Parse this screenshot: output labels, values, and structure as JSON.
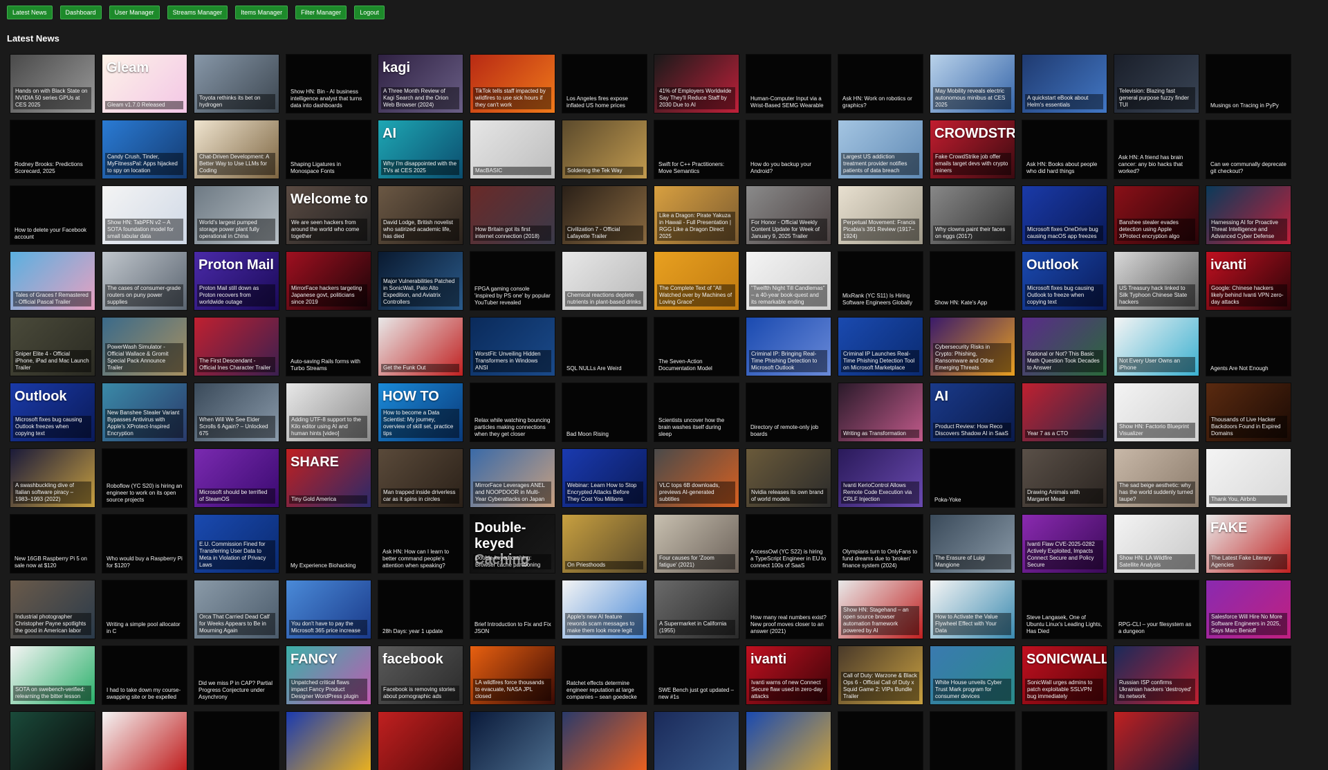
{
  "nav": [
    {
      "label": "Latest News",
      "name": "nav-latest-news-button"
    },
    {
      "label": "Dashboard",
      "name": "nav-dashboard-button"
    },
    {
      "label": "User Manager",
      "name": "nav-user-manager-button"
    },
    {
      "label": "Streams Manager",
      "name": "nav-streams-manager-button"
    },
    {
      "label": "Items Manager",
      "name": "nav-items-manager-button"
    },
    {
      "label": "Filter Manager",
      "name": "nav-filter-manager-button"
    },
    {
      "label": "Logout",
      "name": "nav-logout-button"
    }
  ],
  "page_title": "Latest News",
  "colors": {
    "accent": "#1d8a2a",
    "page_bg": "#1a1a1a",
    "card_bg": "#050505"
  },
  "news": [
    {
      "title": "Hands on with Black State on NVIDIA 50 series GPUs at CES 2025",
      "thumb": "#4a4a4a,#9a9a9a"
    },
    {
      "title": "Gleam v1.7.0 Released",
      "thumb": "#fdf3e8,#f3c6e6",
      "text": "Gleam"
    },
    {
      "title": "Toyota rethinks its bet on hydrogen",
      "thumb": "#8797a8,#3c4650"
    },
    {
      "title": "Show HN: Bin - AI business intelligence analyst that turns data into dashboards",
      "thumb": ""
    },
    {
      "title": "A Three Month Review of Kagi Search and the Orion Web Browser (2024)",
      "thumb": "#2f2142,#6a5f86",
      "text": "kagi"
    },
    {
      "title": "TikTok tells staff impacted by wildfires to use sick hours if they can't work",
      "thumb": "#b82a14,#f07a1a"
    },
    {
      "title": "Los Angeles fires expose inflated US home prices",
      "thumb": ""
    },
    {
      "title": "41% of Employers Worldwide Say They'll Reduce Staff by 2030 Due to AI",
      "thumb": "#1a1a1a,#c0203a"
    },
    {
      "title": "Human-Computer Input via a Wrist-Based SEMG Wearable",
      "thumb": ""
    },
    {
      "title": "Ask HN: Work on robotics or graphics?",
      "thumb": ""
    },
    {
      "title": "May Mobility reveals electric autonomous minibus at CES 2025",
      "thumb": "#b9d2ea,#3464a8"
    },
    {
      "title": "A quickstart eBook about Helm's essentials",
      "thumb": "#1f3a70,#4277c4"
    },
    {
      "title": "Television: Blazing fast general purpose fuzzy finder TUI",
      "thumb": "#1a1f2a,#3a4556"
    },
    {
      "title": "Musings on Tracing in PyPy",
      "thumb": ""
    },
    {
      "title": "Rodney Brooks: Predictions Scorecard, 2025",
      "thumb": ""
    },
    {
      "title": "Candy Crush, Tinder, MyFitnessPal: Apps hijacked to spy on location",
      "thumb": "#2a7bd4,#143a70"
    },
    {
      "title": "Chat-Driven Development: A Better Way to Use LLMs for Coding",
      "thumb": "#efe4cf,#7c6440"
    },
    {
      "title": "Shaping Ligatures in Monospace Fonts",
      "thumb": ""
    },
    {
      "title": "Why I'm disappointed with the TVs at CES 2025",
      "thumb": "#1ea7b4,#0b4d6e",
      "text": "AI"
    },
    {
      "title": "MacBASIC",
      "thumb": "#e6e6e6,#bdbdbd"
    },
    {
      "title": "Soldering the Tek Way",
      "thumb": "#5b4a2c,#c29b4f"
    },
    {
      "title": "Swift for C++ Practitioners: Move Semantics",
      "thumb": ""
    },
    {
      "title": "How do you backup your Android?",
      "thumb": ""
    },
    {
      "title": "Largest US addiction treatment provider notifies patients of data breach",
      "thumb": "#a4c5e2,#5f89b4"
    },
    {
      "title": "Fake CrowdStrike job offer emails target devs with crypto miners",
      "thumb": "#c21d2f,#3a0a10",
      "text": "CROWDSTRIKE"
    },
    {
      "title": "Ask HN: Books about people who did hard things",
      "thumb": ""
    },
    {
      "title": "Ask HN: A friend has brain cancer: any bio hacks that worked?",
      "thumb": ""
    },
    {
      "title": "Can we communally deprecate git checkout?",
      "thumb": ""
    },
    {
      "title": "How to delete your Facebook account",
      "thumb": ""
    },
    {
      "title": "Show HN: TabPFN v2 – A SOTA foundation model for small tabular data",
      "thumb": "#f4f4f4,#cfd8e6"
    },
    {
      "title": "World's largest pumped storage power plant fully operational in China",
      "thumb": "#6e7a84,#b8c0c6"
    },
    {
      "title": "We are seen hackers from around the world who come together",
      "thumb": "#5a4a42,#222",
      "text": "Welcome to"
    },
    {
      "title": "David Lodge, British novelist who satirized academic life, has died",
      "thumb": "#6b5844,#2a221c"
    },
    {
      "title": "How Britain got its first internet connection (2018)",
      "thumb": "#6a2a28,#3a3a4a"
    },
    {
      "title": "Civilization 7 - Official Lafayette Trailer",
      "thumb": "#2a2018,#8a6a40"
    },
    {
      "title": "Like a Dragon: Pirate Yakuza in Hawaii - Full Presentation | RGG Like a Dragon Direct 2025",
      "thumb": "#d8a040,#7a5a30"
    },
    {
      "title": "For Honor - Official Weekly Content Update for Week of January 9, 2025 Trailer",
      "thumb": "#8a8a8a,#4a4040"
    },
    {
      "title": "Perpetual Movement: Francis Picabia's 391 Review (1917–1924)",
      "thumb": "#e8e0d0,#a09a8a"
    },
    {
      "title": "Why clowns paint their faces on eggs (2017)",
      "thumb": "#888,#333"
    },
    {
      "title": "Microsoft fixes OneDrive bug causing macOS app freezes",
      "thumb": "#1a3aa8,#0a1a58"
    },
    {
      "title": "Banshee stealer evades detection using Apple XProtect encryption algo",
      "thumb": "#8a1018,#2a0408"
    },
    {
      "title": "Harnessing AI for Proactive Threat Intelligence and Advanced Cyber Defense",
      "thumb": "#0a3a5a,#c0203a"
    },
    {
      "title": "Tales of Graces f Remastered - Official Pascal Trailer",
      "thumb": "#5ab0e0,#e8a0c0"
    },
    {
      "title": "The cases of consumer-grade routers on puny power supplies",
      "thumb": "#c0c6cc,#5a6470"
    },
    {
      "title": "Proton Mail still down as Proton recovers from worldwide outage",
      "thumb": "#4a2aa8,#1a0a58",
      "text": "Proton Mail"
    },
    {
      "title": "MirrorFace hackers targeting Japanese govt, politicians since 2019",
      "thumb": "#a01020,#1a0408"
    },
    {
      "title": "Major Vulnerabilities Patched in SonicWall, Palo Alto Expedition, and Aviatrix Controllers",
      "thumb": "#0a1a30,#2a5a8a"
    },
    {
      "title": "FPGA gaming console 'inspired by PS one' by popular YouTuber revealed",
      "thumb": ""
    },
    {
      "title": "Chemical reactions deplete nutrients in plant-based drinks",
      "thumb": "#e8e8e8,#b8b8b8"
    },
    {
      "title": "The Complete Text of \"All Watched over by Machines of Loving Grace\"",
      "thumb": "#e8a020,#c07a10"
    },
    {
      "title": "\"Twelfth Night Till Candlemas\" – a 40-year book-quest and its remarkable ending",
      "thumb": "#f4f4f4,#d0d0d0"
    },
    {
      "title": "MixRank (YC S11) Is Hiring Software Engineers Globally",
      "thumb": ""
    },
    {
      "title": "Show HN: Kate's App",
      "thumb": ""
    },
    {
      "title": "Microsoft fixes bug causing Outlook to freeze when copying text",
      "thumb": "#1a4ab0,#0a1a58",
      "text": "Outlook"
    },
    {
      "title": "US Treasury hack linked to Silk Typhoon Chinese State hackers",
      "thumb": "#d8d8d8,#5a5a5a"
    },
    {
      "title": "Google: Chinese hackers likely behind Ivanti VPN zero-day attacks",
      "thumb": "#c01020,#2a0408",
      "text": "ivanti"
    },
    {
      "title": "Sniper Elite 4 - Official iPhone, iPad and Mac Launch Trailer",
      "thumb": "#4a4a3a,#2a2a22"
    },
    {
      "title": "PowerWash Simulator - Official Wallace & Gromit Special Pack Announce Trailer",
      "thumb": "#3a6a8a,#a89060"
    },
    {
      "title": "The First Descendant - Official Ines Character Trailer",
      "thumb": "#c02030,#3a2050"
    },
    {
      "title": "Auto-saving Rails forms with Turbo Streams",
      "thumb": ""
    },
    {
      "title": "Get the Funk Out",
      "thumb": "#e8e8e8,#c02020"
    },
    {
      "title": "WorstFit: Unveiling Hidden Transformers in Windows ANSI",
      "thumb": "#0a2a5a,#1a4a8a"
    },
    {
      "title": "SQL NULLs Are Weird",
      "thumb": ""
    },
    {
      "title": "The Seven-Action Documentation Model",
      "thumb": ""
    },
    {
      "title": "Criminal IP: Bringing Real-Time Phishing Detection to Microsoft Outlook",
      "thumb": "#1a4ab0,#6a8ad8"
    },
    {
      "title": "Criminal IP Launches Real-Time Phishing Detection Tool on Microsoft Marketplace",
      "thumb": "#1a4ab0,#0a2a70"
    },
    {
      "title": "Cybersecurity Risks in Crypto: Phishing, Ransomware and Other Emerging Threats",
      "thumb": "#3a1a6a,#e8a020"
    },
    {
      "title": "Rational or Not? This Basic Math Question Took Decades to Answer",
      "thumb": "#5a2a8a,#2a6a3a"
    },
    {
      "title": "Not Every User Owns an iPhone",
      "thumb": "#f4f4f4,#3ab0d0"
    },
    {
      "title": "Agents Are Not Enough",
      "thumb": ""
    },
    {
      "title": "Microsoft fixes bug causing Outlook freezes when copying text",
      "thumb": "#1a3aa8,#0a1a58",
      "text": "Outlook"
    },
    {
      "title": "New Banshee Stealer Variant Bypasses Antivirus with Apple's XProtect-Inspired Encryption",
      "thumb": "#3a8aa8,#2a3a6a"
    },
    {
      "title": "When Will We See Elder Scrolls 6 Again? – Unlocked 675",
      "thumb": "#3a4a5a,#8a9aaa"
    },
    {
      "title": "Adding UTF-8 support to the Kilo editor using AI and human hints [video]",
      "thumb": "#e8e8e8,#8a8a8a"
    },
    {
      "title": "How to become a Data Scientist: My journey, overview of skill set, practice tips",
      "thumb": "#1a8ad8,#0a3a7a",
      "text": "HOW TO"
    },
    {
      "title": "Relax while watching bouncing particles making connections when they get closer",
      "thumb": ""
    },
    {
      "title": "Bad Moon Rising",
      "thumb": ""
    },
    {
      "title": "Scientists uncover how the brain washes itself during sleep",
      "thumb": ""
    },
    {
      "title": "Directory of remote-only job boards",
      "thumb": ""
    },
    {
      "title": "Writing as Transformation",
      "thumb": "#2a1a2a,#c05a8a"
    },
    {
      "title": "Product Review: How Reco Discovers Shadow AI in SaaS",
      "thumb": "#1a3a8a,#0a1a4a",
      "text": "AI"
    },
    {
      "title": "Year 7 as a CTO",
      "thumb": "#c02030,#2a2a4a"
    },
    {
      "title": "Show HN: Factorio Blueprint Visualizer",
      "thumb": "#f4f4f4,#d0d0d0"
    },
    {
      "title": "Thousands of Live Hacker Backdoors Found in Expired Domains",
      "thumb": "#5a2a10,#1a0a04"
    },
    {
      "title": "A swashbuckling dive of Italian software piracy – 1983–1993 (2022)",
      "thumb": "#1a1a3a,#c8a040"
    },
    {
      "title": "Roboflow (YC S20) is hiring an engineer to work on its open source projects",
      "thumb": ""
    },
    {
      "title": "Microsoft should be terrified of SteamOS",
      "thumb": "#7a2ab0,#3a0a70"
    },
    {
      "title": "Tiny Gold America",
      "thumb": "#c02020,#2a2a6a",
      "text": "SHARE"
    },
    {
      "title": "Man trapped inside driverless car as it spins in circles",
      "thumb": "#5a4a3a,#2a2018"
    },
    {
      "title": "MirrorFace Leverages ANEL and NOOPDOOR in Multi-Year Cyberattacks on Japan",
      "thumb": "#3a6aa8,#c8a080"
    },
    {
      "title": "Webinar: Learn How to Stop Encrypted Attacks Before They Cost You Millions",
      "thumb": "#1a3ab0,#0a1a58"
    },
    {
      "title": "VLC tops 6B downloads, previews AI-generated subtitles",
      "thumb": "#4a4a4a,#d86020"
    },
    {
      "title": "Nvidia releases its own brand of world models",
      "thumb": "#6a5a3a,#2a2a2a"
    },
    {
      "title": "Ivanti KerioControl Allows Remote Code Execution via CRLF Injection",
      "thumb": "#2a1a5a,#6a4ab0"
    },
    {
      "title": "Poka-Yoke",
      "thumb": ""
    },
    {
      "title": "Drawing Animals with Margaret Mead",
      "thumb": "#5a5048,#2a2420"
    },
    {
      "title": "The sad beige aesthetic: why has the world suddenly turned taupe?",
      "thumb": "#c8b8a8,#8a7a6a"
    },
    {
      "title": "Thank You, Airbnb",
      "thumb": "#f4f4f4,#d8d8d8"
    },
    {
      "title": "New 16GB Raspberry Pi 5 on sale now at $120",
      "thumb": ""
    },
    {
      "title": "Who would buy a Raspberry Pi for $120?",
      "thumb": ""
    },
    {
      "title": "E.U. Commission Fined for Transferring User Data to Meta in Violation of Privacy Laws",
      "thumb": "#1a4ab0,#0a2a70"
    },
    {
      "title": "My Experience Biohacking",
      "thumb": ""
    },
    {
      "title": "Ask HN: How can I learn to better command people's attention when speaking?",
      "thumb": ""
    },
    {
      "title": "Double-keyed caching: Browser cache partitioning",
      "thumb": "#0a0a0a,#1a1a1a",
      "text": "Double-keyed Caching"
    },
    {
      "title": "On Priesthoods",
      "thumb": "#c8a040,#5a4a2a"
    },
    {
      "title": "Four causes for 'Zoom fatigue' (2021)",
      "thumb": "#c8c0b0,#6a6058"
    },
    {
      "title": "AccessOwl (YC S22) is hiring a TypeScript Engineer in EU to connect 100s of SaaS",
      "thumb": ""
    },
    {
      "title": "Olympians turn to OnlyFans to fund dreams due to 'broken' finance system (2024)",
      "thumb": ""
    },
    {
      "title": "The Erasure of Luigi Mangione",
      "thumb": "#3a4a5a,#8a9aa8"
    },
    {
      "title": "Ivanti Flaw CVE-2025-0282 Actively Exploited, Impacts Connect Secure and Policy Secure",
      "thumb": "#8a2ab0,#3a0a58"
    },
    {
      "title": "Show HN: LA Wildfire Satellite Analysis",
      "thumb": "#f4f4f4,#c8c8c8"
    },
    {
      "title": "The Latest Fake Literary Agencies",
      "thumb": "#e8e8e8,#c02020",
      "text": "FAKE"
    },
    {
      "title": "Industrial photographer Christopher Payne spotlights the good in American labor",
      "thumb": "#6a5a4a,#2a3a4a"
    },
    {
      "title": "Writing a simple pool allocator in C",
      "thumb": ""
    },
    {
      "title": "Orca That Carried Dead Calf for Weeks Appears to Be in Mourning Again",
      "thumb": "#8a9aa8,#4a5a6a"
    },
    {
      "title": "You don't have to pay the Microsoft 365 price increase",
      "thumb": "#4a8ad8,#1a3a8a"
    },
    {
      "title": "28h Days: year 1 update",
      "thumb": ""
    },
    {
      "title": "Brief Introduction to Fix and Fix JSON",
      "thumb": ""
    },
    {
      "title": "Apple's new AI feature rewords scam messages to make them look more legit",
      "thumb": "#f4f4f4,#4a8ad8"
    },
    {
      "title": "A Supermarket in California (1955)",
      "thumb": "#6a6a6a,#2a2a2a"
    },
    {
      "title": "How many real numbers exist? New proof moves closer to an answer (2021)",
      "thumb": ""
    },
    {
      "title": "Show HN: Stagehand – an open source browser automation framework powered by AI",
      "thumb": "#e8e8e8,#c02020"
    },
    {
      "title": "How to Activate the Value Flywheel Effect with Your Data",
      "thumb": "#f4f4f4,#3a8ab0"
    },
    {
      "title": "Steve Langasek, One of Ubuntu Linux's Leading Lights, Has Died",
      "thumb": ""
    },
    {
      "title": "RPG-CLI – your filesystem as a dungeon",
      "thumb": ""
    },
    {
      "title": "Salesforce Will Hire No More Software Engineers in 2025, Says Marc Benioff",
      "thumb": "#8a2ab0,#c02080"
    },
    {
      "title": "SOTA on swebench-verified: relearning the bitter lesson",
      "thumb": "#f4f4f4,#2ab06a"
    },
    {
      "title": "I had to take down my course-swapping site or be expelled",
      "thumb": ""
    },
    {
      "title": "Did we miss P in CAP? Partial Progress Conjecture under Asynchrony",
      "thumb": ""
    },
    {
      "title": "Unpatched critical flaws impact Fancy Product Designer WordPress plugin",
      "thumb": "#3ab0a8,#c05ab0",
      "text": "FANCY"
    },
    {
      "title": "Facebook is removing stories about pornographic ads",
      "thumb": "#5a5a5a,#2a2a2a",
      "text": "facebook"
    },
    {
      "title": "LA wildfires force thousands to evacuate, NASA JPL closed",
      "thumb": "#e86010,#3a0a04"
    },
    {
      "title": "Ratchet effects determine engineer reputation at large companies – sean goedecke",
      "thumb": ""
    },
    {
      "title": "SWE Bench just got updated – new #1s",
      "thumb": ""
    },
    {
      "title": "Ivanti warns of new Connect Secure flaw used in zero-day attacks",
      "thumb": "#c01020,#3a0408",
      "text": "ivanti"
    },
    {
      "title": "Call of Duty: Warzone & Black Ops 6 - Official Call of Duty x Squid Game 2: VIPs Bundle Trailer",
      "thumb": "#4a3a2a,#c8a040"
    },
    {
      "title": "White House unveils Cyber Trust Mark program for consumer devices",
      "thumb": "#3a7ab0,#2a8a8a"
    },
    {
      "title": "SonicWall urges admins to patch exploitable SSLVPN bug immediately",
      "thumb": "#c01020,#5a0408",
      "text": "SONICWALL"
    },
    {
      "title": "Russian ISP confirms Ukrainian hackers 'destroyed' its network",
      "thumb": "#1a2a5a,#c02030"
    },
    {
      "title": "",
      "thumb": ""
    },
    {
      "title": "",
      "thumb": "#1a4a3a,#0a0a0a"
    },
    {
      "title": "",
      "thumb": "#f4f4f4,#c02020"
    },
    {
      "title": "",
      "thumb": ""
    },
    {
      "title": "",
      "thumb": "#1a3ab0,#e8b020"
    },
    {
      "title": "",
      "thumb": "#c02020,#5a0a0a"
    },
    {
      "title": "",
      "thumb": "#0a1a3a,#4a6a8a"
    },
    {
      "title": "",
      "thumb": "#2a3a6a,#e86020"
    },
    {
      "title": "",
      "thumb": "#1a2a5a,#3a5a8a"
    },
    {
      "title": "",
      "thumb": "#1a4ab0,#c8a040"
    },
    {
      "title": "",
      "thumb": ""
    },
    {
      "title": "",
      "thumb": ""
    },
    {
      "title": "",
      "thumb": ""
    },
    {
      "title": "",
      "thumb": "#c02020,#1a1a3a"
    }
  ]
}
